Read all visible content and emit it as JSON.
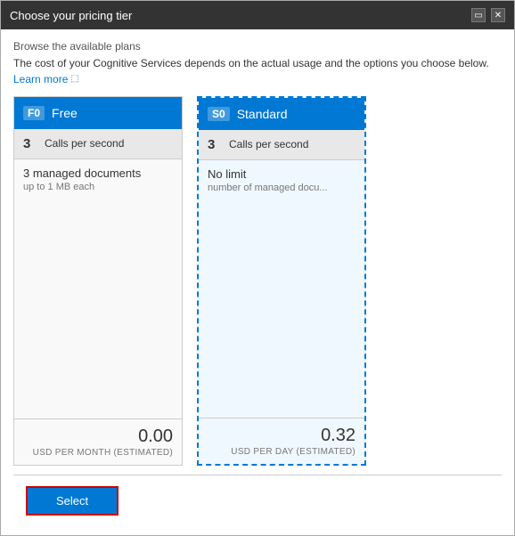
{
  "window": {
    "title": "Choose your pricing tier",
    "subtitle": "Browse the available plans",
    "controls": {
      "restore_label": "▭",
      "close_label": "✕"
    }
  },
  "description": {
    "main_text": "The cost of your Cognitive Services depends on the actual usage and the options you choose below.",
    "learn_more_label": "Learn more",
    "learn_more_icon": "🔗"
  },
  "tiers": [
    {
      "id": "f0",
      "badge": "F0",
      "name": "Free",
      "feature_number": "3",
      "feature_label": "Calls per second",
      "detail_main": "3 managed documents",
      "detail_sub": "up to 1 MB each",
      "price": "0.00",
      "price_label": "USD PER MONTH (ESTIMATED)",
      "selected": false
    },
    {
      "id": "s0",
      "badge": "S0",
      "name": "Standard",
      "feature_number": "3",
      "feature_label": "Calls per second",
      "detail_main": "No limit",
      "detail_sub": "number of managed docu...",
      "price": "0.32",
      "price_label": "USD PER DAY (ESTIMATED)",
      "selected": true
    }
  ],
  "buttons": {
    "select_label": "Select"
  }
}
